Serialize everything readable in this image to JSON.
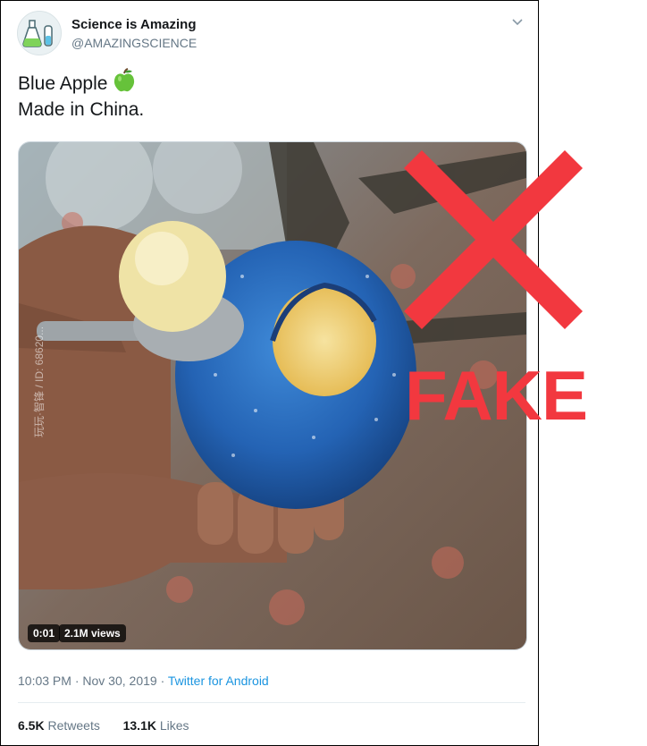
{
  "tweet": {
    "author_name": "Science is Amazing",
    "author_handle": "@AMAZINGSCIENCE",
    "text_line1": "Blue Apple",
    "text_line2": "Made in China.",
    "emoji_icon": "green-apple-icon"
  },
  "media": {
    "timestamp": "0:01",
    "views": "2.1M views",
    "watermark": "玩玩·智锋 / ID: 68620..."
  },
  "meta": {
    "time": "10:03 PM",
    "separator": " · ",
    "date": "Nov 30, 2019",
    "source": "Twitter for Android"
  },
  "stats": {
    "retweets_count": "6.5K",
    "retweets_label": "Retweets",
    "likes_count": "13.1K",
    "likes_label": "Likes"
  },
  "overlay": {
    "label": "FAKE",
    "color": "#f2383f"
  }
}
